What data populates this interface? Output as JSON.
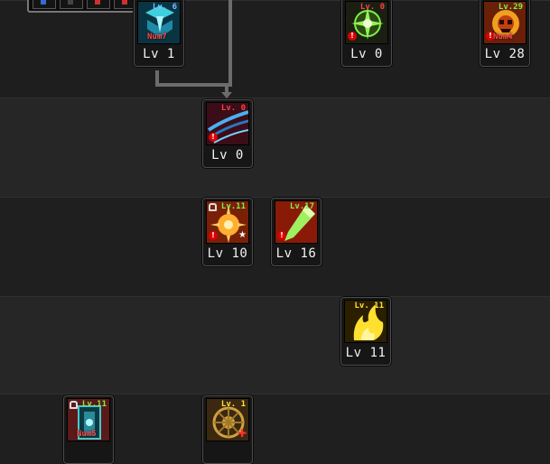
{
  "quickbar": {
    "slots": [
      "quickslot-1",
      "quickslot-2",
      "quickslot-3",
      "quickslot-4"
    ]
  },
  "skills": [
    {
      "id": "s1",
      "level_text": "Lv 1",
      "top_level": "Lv. 6",
      "top_color": "#7fb8ff",
      "keybind": "Num7",
      "icon": "frost-crest-icon",
      "palette": [
        "#0a3f52",
        "#3fd0e0"
      ]
    },
    {
      "id": "s2",
      "level_text": "Lv 0",
      "top_level": "Lv. 0",
      "top_color": "#ff4040",
      "keybind": "",
      "icon": "green-burst-icon",
      "palette": [
        "#1c2a14",
        "#7df04a"
      ]
    },
    {
      "id": "s3",
      "level_text": "Lv 28",
      "top_level": "Lv.29",
      "top_color": "#7df04a",
      "keybind": "Num4",
      "icon": "fire-skull-icon",
      "palette": [
        "#5a1f06",
        "#f0a020"
      ]
    },
    {
      "id": "s4",
      "level_text": "Lv 0",
      "top_level": "Lv. 0",
      "top_color": "#ff4040",
      "keybind": "",
      "icon": "wind-slash-icon",
      "palette": [
        "#3a0d14",
        "#4ab0f0"
      ]
    },
    {
      "id": "s5",
      "level_text": "Lv 10",
      "top_level": "Lv.11",
      "top_color": "#7df04a",
      "keybind": "",
      "icon": "sun-flare-icon",
      "palette": [
        "#6a1a08",
        "#ffae30"
      ]
    },
    {
      "id": "s6",
      "level_text": "Lv 16",
      "top_level": "Lv.17",
      "top_color": "#7df04a",
      "keybind": "",
      "icon": "green-strike-icon",
      "palette": [
        "#7a1208",
        "#9ef060"
      ]
    },
    {
      "id": "s7",
      "level_text": "Lv 11",
      "top_level": "Lv. 11",
      "top_color": "#ffe040",
      "keybind": "",
      "icon": "lightning-flame-icon",
      "palette": [
        "#3a2a00",
        "#ffe030"
      ]
    },
    {
      "id": "s8",
      "level_text": "",
      "top_level": "Lv.11",
      "top_color": "#7df04a",
      "keybind": "Num5",
      "icon": "spirit-gate-icon",
      "palette": [
        "#0c2e3a",
        "#48c8c8"
      ]
    },
    {
      "id": "s9",
      "level_text": "",
      "top_level": "Lv. 1",
      "top_color": "#ffe040",
      "keybind": "",
      "icon": "golden-wheel-icon",
      "palette": [
        "#2a1a06",
        "#d0a040"
      ]
    }
  ]
}
